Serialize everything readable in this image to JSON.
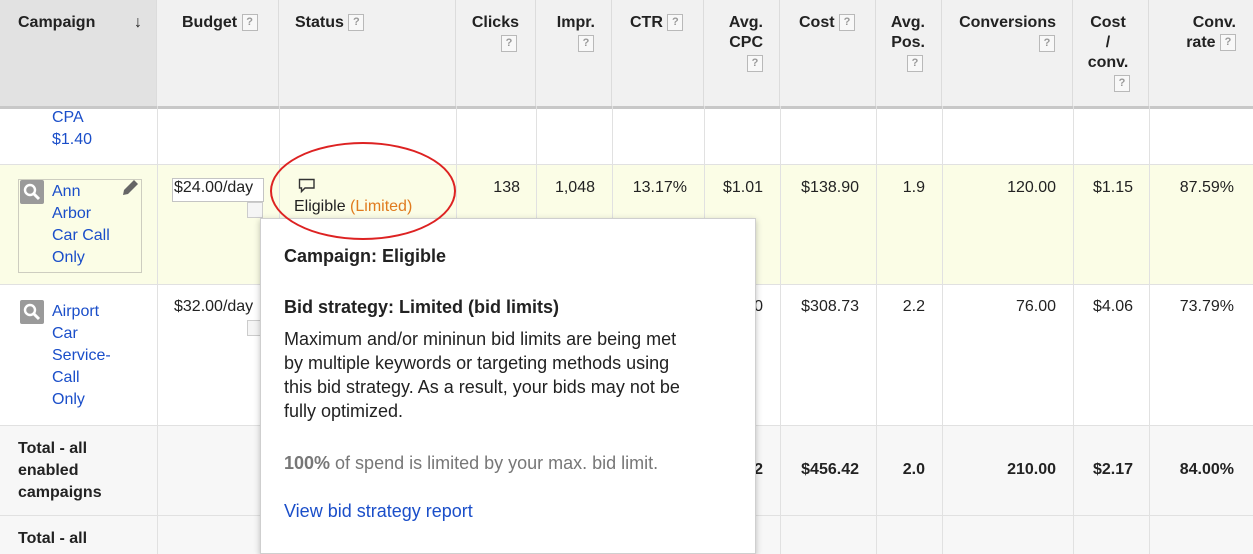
{
  "columns": {
    "campaign": "Campaign",
    "budget": "Budget",
    "status": "Status",
    "clicks": "Clicks",
    "impr": "Impr.",
    "ctr": "CTR",
    "avg_cpc_1": "Avg.",
    "avg_cpc_2": "CPC",
    "cost": "Cost",
    "avg_pos_1": "Avg.",
    "avg_pos_2": "Pos.",
    "conversions": "Conversions",
    "cost_conv_1": "Cost",
    "cost_conv_2": "/",
    "cost_conv_3": "conv.",
    "conv_rate_1": "Conv.",
    "conv_rate_2": "rate",
    "help": "?",
    "sort_arrow": "↓"
  },
  "partial_row": {
    "line1": "CPA",
    "line2": "$1.40"
  },
  "rows": [
    {
      "name_lines": [
        "Ann",
        "Arbor",
        "Car Call",
        "Only"
      ],
      "budget": "$24.00/day",
      "status": "Eligible",
      "status_note": "(Limited)",
      "clicks": "138",
      "impr": "1,048",
      "ctr": "13.17%",
      "avg_cpc": "$1.01",
      "cost": "$138.90",
      "avg_pos": "1.9",
      "conversions": "120.00",
      "cost_conv": "$1.15",
      "conv_rate": "87.59%"
    },
    {
      "name_lines": [
        "Airport",
        "Car",
        "Service-",
        "Call",
        "Only"
      ],
      "budget": "$32.00/day",
      "avg_cpc_partial": "0",
      "cost": "$308.73",
      "avg_pos": "2.2",
      "conversions": "76.00",
      "cost_conv": "$4.06",
      "conv_rate": "73.79%"
    }
  ],
  "total_enabled": {
    "label_lines": [
      "Total - all",
      "enabled",
      "campaigns"
    ],
    "avg_cpc_partial": "2",
    "cost": "$456.42",
    "avg_pos": "2.0",
    "conversions": "210.00",
    "cost_conv": "$2.17",
    "conv_rate": "84.00%"
  },
  "total_all": {
    "label": "Total - all"
  },
  "tooltip": {
    "campaign_status": "Campaign: Eligible",
    "bid_strategy_title": "Bid strategy: Limited (bid limits)",
    "bid_strategy_lines": [
      "Maximum and/or mininun bid limits are being met",
      "by multiple keywords or targeting methods using",
      "this bid strategy. As a result, your bids may not be",
      "fully optimized."
    ],
    "spend_pct": "100%",
    "spend_text": " of spend is limited by your max. bid limit.",
    "report_link": "View bid strategy report"
  },
  "colors": {
    "link": "#1a4ec9",
    "limited": "#e07b1f",
    "highlight_row": "#fbfde6",
    "annotation": "#dd2222"
  }
}
